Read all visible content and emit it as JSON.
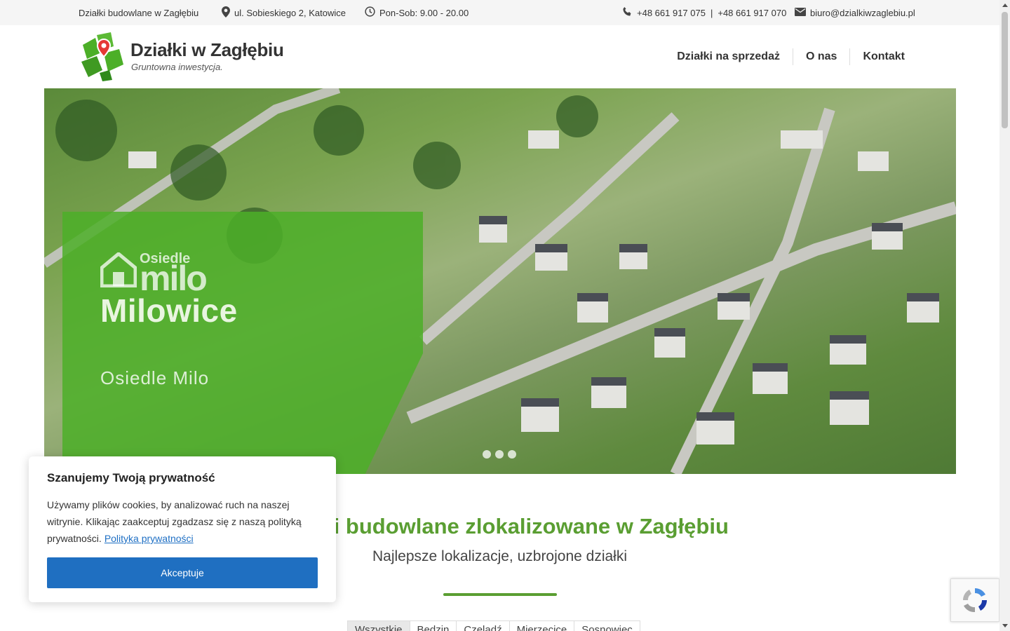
{
  "topbar": {
    "tagline": "Działki budowlane w Zagłębiu",
    "address": "ul. Sobieskiego 2, Katowice",
    "hours": "Pon-Sob: 9.00 - 20.00",
    "phone1": "+48 661 917 075",
    "phone_separator": "|",
    "phone2": "+48 661 917 070",
    "email": "biuro@dzialkiwzaglebiu.pl"
  },
  "logo": {
    "title": "Działki w Zagłębiu",
    "subtitle": "Gruntowna inwestycja."
  },
  "nav": {
    "items": [
      "Działki na sprzedaż",
      "O nas",
      "Kontakt"
    ]
  },
  "hero": {
    "brand_small": "Osiedle",
    "brand_large": "milo",
    "title": "Milowice",
    "subtitle": "Osiedle Milo",
    "slide_count": 3
  },
  "main": {
    "title": "Działki budowlane zlokalizowane w Zagłębiu",
    "subtitle": "Najlepsze lokalizacje, uzbrojone działki",
    "filters": [
      "Wszystkie",
      "Będzin",
      "Czeladź",
      "Mierzęcice",
      "Sosnowiec"
    ]
  },
  "cookie": {
    "title": "Szanujemy Twoją prywatność",
    "text": "Używamy plików cookies, by analizować ruch na naszej witrynie. Klikając zaakceptuj zgadzasz się z naszą polityką prywatności.",
    "link": "Polityka prywatności",
    "button": "Akceptuje"
  },
  "colors": {
    "accent": "#5a9e32",
    "button": "#1f6fc1",
    "overlay": "#4caf28"
  }
}
